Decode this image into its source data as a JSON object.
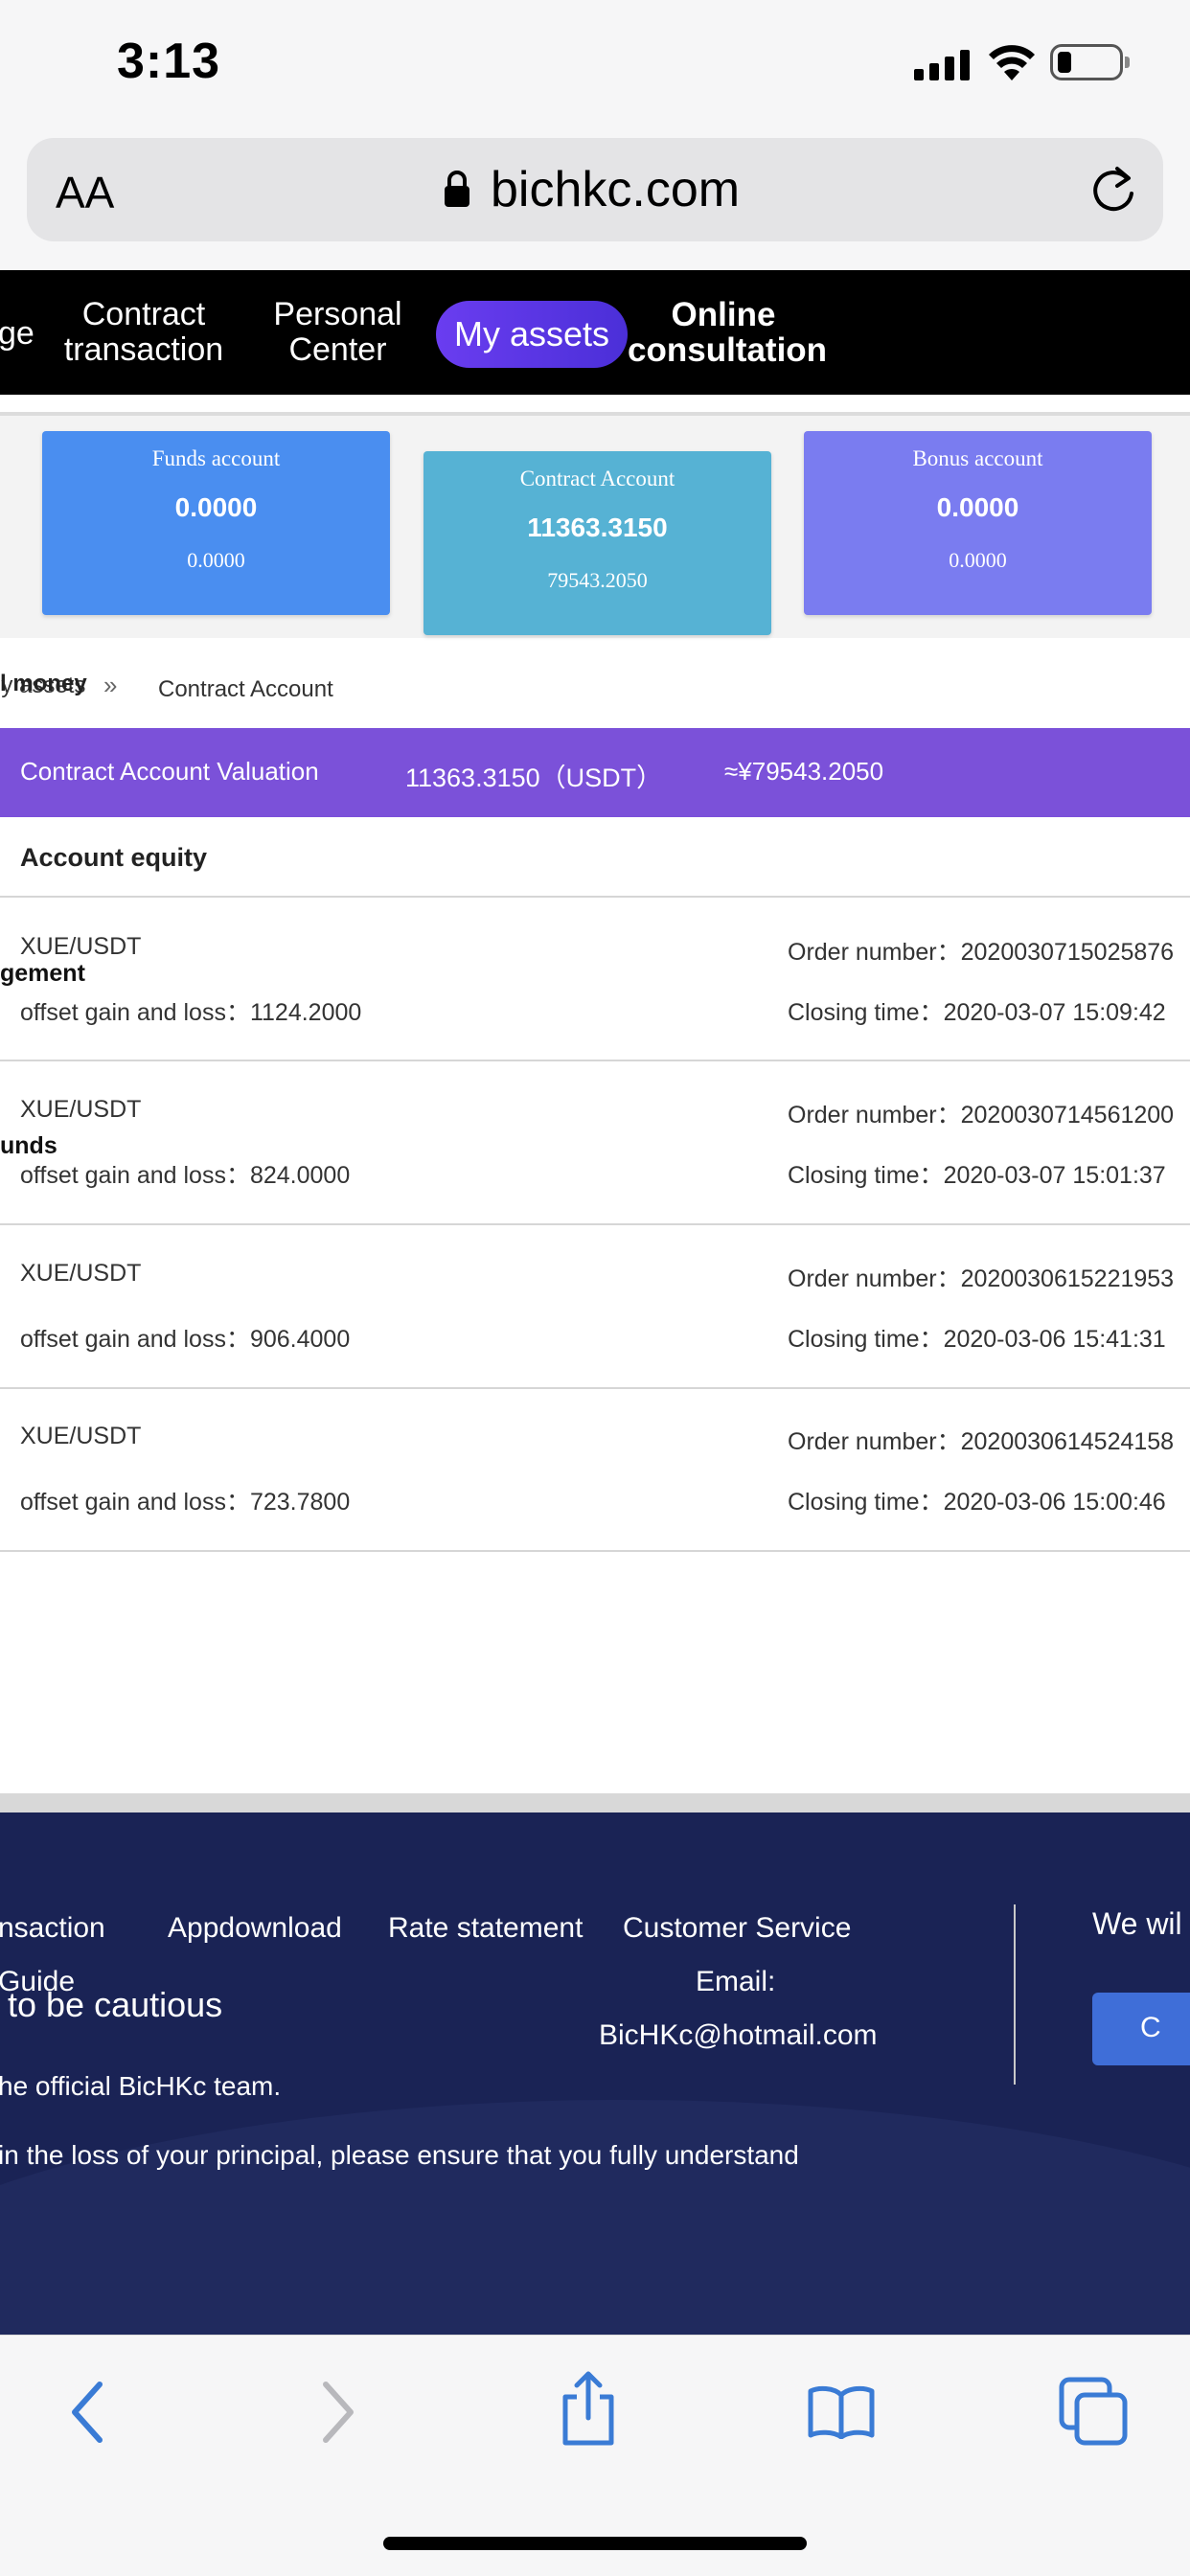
{
  "status": {
    "time": "3:13"
  },
  "browser": {
    "aa_label": "AA",
    "domain": "bichkc.com"
  },
  "nav": {
    "items": [
      {
        "label": "ge"
      },
      {
        "label": "Contract transaction"
      },
      {
        "label": "Personal Center"
      },
      {
        "label": "My assets",
        "active": true
      },
      {
        "label": "Online consultation"
      }
    ]
  },
  "cards": [
    {
      "title": "Funds account",
      "value": "0.0000",
      "sub": "0.0000",
      "color": "#4a8ef0"
    },
    {
      "title": "Contract Account",
      "value": "11363.3150",
      "sub": "79543.2050",
      "color": "#56b2d4"
    },
    {
      "title": "Bonus account",
      "value": "0.0000",
      "sub": "0.0000",
      "color": "#7a7cf0"
    }
  ],
  "breadcrumb": {
    "root_under": "ly assets",
    "root_over": "l money",
    "separator": "»",
    "current": "Contract Account"
  },
  "valuation": {
    "label": "Contract Account Valuation",
    "amount": "11363.3150（USDT）",
    "cny": "≈¥79543.2050",
    "color": "#7b51d9"
  },
  "equity_title": "Account equity",
  "sidebar_overlay": {
    "item1": "gement",
    "item2": "unds"
  },
  "rows": [
    {
      "pair": "XUE/USDT",
      "gain_label": "offset gain and loss：",
      "gain": "1124.2000",
      "order_label": "Order number：",
      "order": "2020030715025876",
      "closing_label": "Closing time：",
      "closing": "2020-03-07 15:09:42"
    },
    {
      "pair": "XUE/USDT",
      "gain_label": "offset gain and loss：",
      "gain": "824.0000",
      "order_label": "Order number：",
      "order": "2020030714561200",
      "closing_label": "Closing time：",
      "closing": "2020-03-07 15:01:37"
    },
    {
      "pair": "XUE/USDT",
      "gain_label": "offset gain and loss：",
      "gain": "906.4000",
      "order_label": "Order number：",
      "order": "2020030615221953",
      "closing_label": "Closing time：",
      "closing": "2020-03-06 15:41:31"
    },
    {
      "pair": "XUE/USDT",
      "gain_label": "offset gain and loss：",
      "gain": "723.7800",
      "order_label": "Order number：",
      "order": "2020030614524158",
      "closing_label": "Closing time：",
      "closing": "2020-03-06 15:00:46"
    }
  ],
  "footer": {
    "links": [
      "nsaction",
      "Appdownload",
      "Rate statement",
      "Customer Service"
    ],
    "guide": "Guide",
    "email_label": "Email:",
    "email": "BicHKc@hotmail.com",
    "cautious": "to be cautious",
    "team": "he official BicHKc team.",
    "warning": "in the loss of your principal, please ensure that you fully understand",
    "right_text": "We wil",
    "right_btn": "C"
  }
}
